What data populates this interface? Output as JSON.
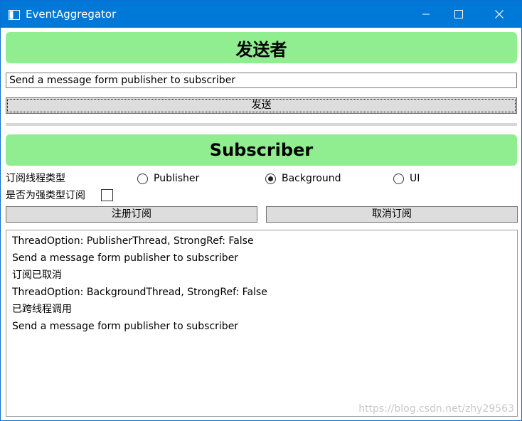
{
  "window": {
    "title": "EventAggregator",
    "icons": {
      "app": "app-window-icon",
      "minimize": "minimize-icon",
      "maximize": "maximize-icon",
      "close": "close-icon"
    }
  },
  "publisher": {
    "header": "发送者",
    "message_value": "Send a message form publisher to subscriber",
    "send_label": "发送"
  },
  "subscriber": {
    "header": "Subscriber",
    "thread_label": "订阅线程类型",
    "options": [
      {
        "label": "Publisher",
        "checked": false
      },
      {
        "label": "Background",
        "checked": true
      },
      {
        "label": "UI",
        "checked": false
      }
    ],
    "strong_ref_label": "是否为强类型订阅",
    "strong_ref_checked": false,
    "register_label": "注册订阅",
    "unsubscribe_label": "取消订阅"
  },
  "log": {
    "lines": [
      "ThreadOption: PublisherThread, StrongRef: False",
      "Send a message form publisher to subscriber",
      "订阅已取消",
      "ThreadOption: BackgroundThread, StrongRef: False",
      "已跨线程调用",
      "Send a message form publisher to subscriber"
    ]
  },
  "watermark": "https://blog.csdn.net/zhy29563",
  "colors": {
    "titlebar": "#0078d7",
    "banner": "#90ee90",
    "button": "#dddddd"
  }
}
